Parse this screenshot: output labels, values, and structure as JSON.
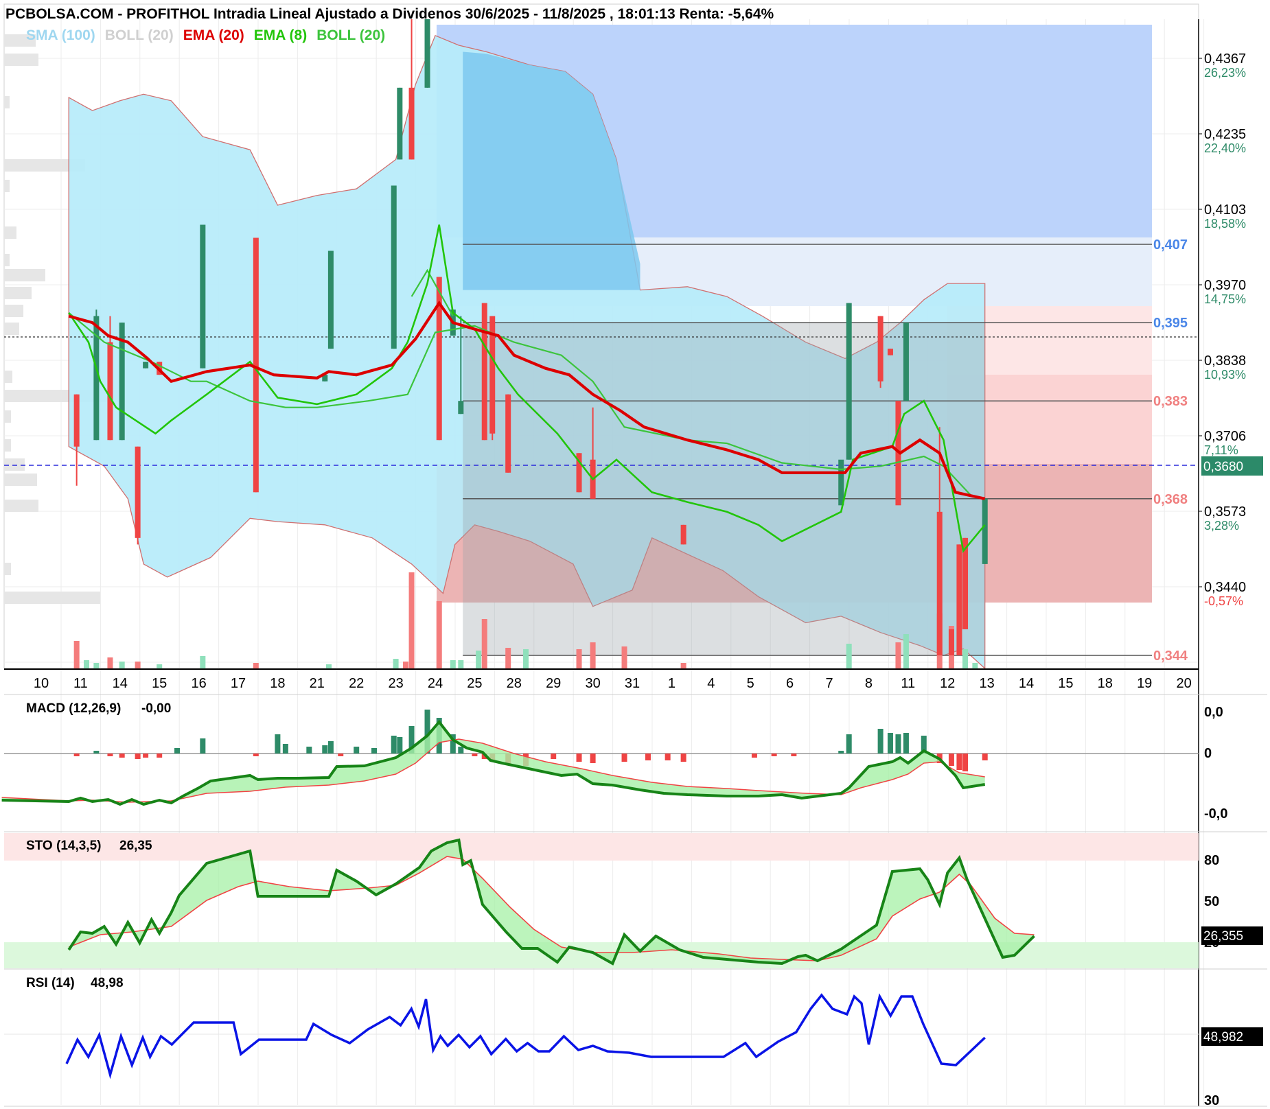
{
  "title": "PCBOLSA.COM - PROFITHOL Intradia Lineal Ajustado a Dividenos 30/6/2025 - 11/8/2025 , 18:01:13 Renta: -5,64%",
  "colors": {
    "up": "#2e8b68",
    "down": "#ef4444",
    "boll_fill": "#b8ecfa",
    "projection": "#bcd3fb",
    "ema20": "#dc0000",
    "ema8": "#22c50a",
    "boll20": "#3cc43c",
    "sma100": "#9fd7f0",
    "current": "#2c8a69",
    "macd": "#178417",
    "rsi": "#0a14e6"
  },
  "legend": [
    {
      "label": "SMA (100)",
      "color": "#9fd7f0"
    },
    {
      "label": "BOLL (20)",
      "color": "#d0d0d0"
    },
    {
      "label": "EMA (20)",
      "color": "#dc0000"
    },
    {
      "label": "EMA (8)",
      "color": "#22c50a"
    },
    {
      "label": "BOLL (20)",
      "color": "#3cc43c"
    }
  ],
  "chart_data": [
    {
      "type": "candlestick",
      "panel": "price",
      "x_tick_labels": [
        "10",
        "11",
        "14",
        "15",
        "16",
        "17",
        "18",
        "21",
        "22",
        "23",
        "24",
        "25",
        "28",
        "29",
        "30",
        "31",
        "1",
        "4",
        "5",
        "6",
        "7",
        "8",
        "11",
        "12",
        "13",
        "14",
        "15",
        "18",
        "19",
        "20"
      ],
      "y_ticks": [
        {
          "price": "0,4367",
          "pct": "26,23%",
          "pct_color": "#2e8b68"
        },
        {
          "price": "0,4235",
          "pct": "22,40%",
          "pct_color": "#2e8b68"
        },
        {
          "price": "0,4103",
          "pct": "18,58%",
          "pct_color": "#2e8b68"
        },
        {
          "price": "0,3970",
          "pct": "14,75%",
          "pct_color": "#2e8b68"
        },
        {
          "price": "0,3838",
          "pct": "10,93%",
          "pct_color": "#2e8b68"
        },
        {
          "price": "0,3706",
          "pct": "7,11%",
          "pct_color": "#2e8b68"
        },
        {
          "price": "0,3573",
          "pct": "3,28%",
          "pct_color": "#2e8b68"
        },
        {
          "price": "0,3440",
          "pct": "-0,57%",
          "pct_color": "#ef4444"
        }
      ],
      "ylim": [
        0.342,
        0.4415
      ],
      "current_price": "0,3680",
      "levels": [
        {
          "value": 0.407,
          "label": "0,407",
          "color": "#4a86e8"
        },
        {
          "value": 0.395,
          "label": "0,395",
          "color": "#4a86e8"
        },
        {
          "value": 0.383,
          "label": "0,383",
          "color": "#f08080"
        },
        {
          "value": 0.368,
          "label": "0,368",
          "color": "#f08080"
        },
        {
          "value": 0.344,
          "label": "0,344",
          "color": "#f08080"
        }
      ],
      "candles": [
        {
          "x": 0.9,
          "o": 0.384,
          "h": 0.384,
          "l": 0.37,
          "c": 0.376,
          "d": "down"
        },
        {
          "x": 1.4,
          "o": 0.377,
          "h": 0.397,
          "l": 0.377,
          "c": 0.396,
          "d": "up"
        },
        {
          "x": 1.75,
          "o": 0.392,
          "h": 0.396,
          "l": 0.377,
          "c": 0.377,
          "d": "down"
        },
        {
          "x": 2.05,
          "o": 0.377,
          "h": 0.395,
          "l": 0.377,
          "c": 0.395,
          "d": "up"
        },
        {
          "x": 2.45,
          "o": 0.376,
          "h": 0.376,
          "l": 0.361,
          "c": 0.362,
          "d": "down"
        },
        {
          "x": 2.65,
          "o": 0.389,
          "h": 0.389,
          "l": 0.388,
          "c": 0.388,
          "d": "up"
        },
        {
          "x": 3.0,
          "o": 0.389,
          "h": 0.389,
          "l": 0.387,
          "c": 0.387,
          "d": "down"
        },
        {
          "x": 4.1,
          "o": 0.388,
          "h": 0.41,
          "l": 0.388,
          "c": 0.41,
          "d": "up"
        },
        {
          "x": 5.45,
          "o": 0.408,
          "h": 0.408,
          "l": 0.369,
          "c": 0.369,
          "d": "down"
        },
        {
          "x": 7.2,
          "o": 0.387,
          "h": 0.387,
          "l": 0.386,
          "c": 0.386,
          "d": "up"
        },
        {
          "x": 7.35,
          "o": 0.391,
          "h": 0.406,
          "l": 0.391,
          "c": 0.406,
          "d": "up"
        },
        {
          "x": 8.95,
          "o": 0.391,
          "h": 0.416,
          "l": 0.391,
          "c": 0.416,
          "d": "up"
        },
        {
          "x": 9.1,
          "o": 0.42,
          "h": 0.431,
          "l": 0.42,
          "c": 0.431,
          "d": "up"
        },
        {
          "x": 9.4,
          "o": 0.431,
          "h": 0.442,
          "l": 0.42,
          "c": 0.42,
          "d": "down"
        },
        {
          "x": 9.8,
          "o": 0.431,
          "h": 0.442,
          "l": 0.431,
          "c": 0.442,
          "d": "up"
        },
        {
          "x": 10.1,
          "o": 0.402,
          "h": 0.402,
          "l": 0.377,
          "c": 0.377,
          "d": "down"
        },
        {
          "x": 10.45,
          "o": 0.393,
          "h": 0.397,
          "l": 0.393,
          "c": 0.397,
          "d": "up"
        },
        {
          "x": 10.65,
          "o": 0.381,
          "h": 0.396,
          "l": 0.381,
          "c": 0.383,
          "d": "up"
        },
        {
          "x": 11.25,
          "o": 0.398,
          "h": 0.398,
          "l": 0.377,
          "c": 0.377,
          "d": "down"
        },
        {
          "x": 11.45,
          "o": 0.396,
          "h": 0.396,
          "l": 0.377,
          "c": 0.378,
          "d": "down"
        },
        {
          "x": 11.85,
          "o": 0.384,
          "h": 0.384,
          "l": 0.372,
          "c": 0.372,
          "d": "down"
        },
        {
          "x": 13.65,
          "o": 0.375,
          "h": 0.375,
          "l": 0.369,
          "c": 0.369,
          "d": "down"
        },
        {
          "x": 14.0,
          "o": 0.374,
          "h": 0.382,
          "l": 0.368,
          "c": 0.368,
          "d": "down"
        },
        {
          "x": 16.3,
          "o": 0.364,
          "h": 0.364,
          "l": 0.361,
          "c": 0.361,
          "d": "down"
        },
        {
          "x": 20.3,
          "o": 0.367,
          "h": 0.367,
          "l": 0.367,
          "c": 0.374,
          "d": "up"
        },
        {
          "x": 20.5,
          "o": 0.374,
          "h": 0.398,
          "l": 0.374,
          "c": 0.398,
          "d": "up"
        },
        {
          "x": 21.3,
          "o": 0.396,
          "h": 0.396,
          "l": 0.385,
          "c": 0.386,
          "d": "down"
        },
        {
          "x": 21.55,
          "o": 0.391,
          "h": 0.391,
          "l": 0.39,
          "c": 0.39,
          "d": "down"
        },
        {
          "x": 21.75,
          "o": 0.383,
          "h": 0.383,
          "l": 0.368,
          "c": 0.367,
          "d": "down"
        },
        {
          "x": 21.95,
          "o": 0.383,
          "h": 0.395,
          "l": 0.383,
          "c": 0.395,
          "d": "up"
        },
        {
          "x": 22.8,
          "o": 0.366,
          "h": 0.379,
          "l": 0.344,
          "c": 0.344,
          "d": "down"
        },
        {
          "x": 23.1,
          "o": 0.348,
          "h": 0.348,
          "l": 0.344,
          "c": 0.344,
          "d": "down"
        },
        {
          "x": 23.3,
          "o": 0.361,
          "h": 0.361,
          "l": 0.344,
          "c": 0.344,
          "d": "down"
        },
        {
          "x": 23.45,
          "o": 0.362,
          "h": 0.362,
          "l": 0.348,
          "c": 0.348,
          "d": "down"
        },
        {
          "x": 23.95,
          "o": 0.358,
          "h": 0.368,
          "l": 0.358,
          "c": 0.368,
          "d": "up"
        }
      ]
    },
    {
      "type": "line",
      "panel": "macd",
      "name": "MACD (12,26,9)",
      "value_label": "-0,00",
      "y_ticks": [
        {
          "label": "0,0",
          "color": "#dc0000"
        },
        {
          "label": "0",
          "color": "#000000"
        },
        {
          "label": "-0,0",
          "color": "#178417"
        }
      ]
    },
    {
      "type": "line",
      "panel": "sto",
      "name": "STO (14,3,5)",
      "value_label": "26,35",
      "current": "26,355",
      "y_ticks": [
        {
          "label": "80",
          "color": "#dc0000"
        },
        {
          "label": "50",
          "color": "#000000"
        },
        {
          "label": "20",
          "color": "#178417"
        }
      ]
    },
    {
      "type": "line",
      "panel": "rsi",
      "name": "RSI (14)",
      "value_label": "48,98",
      "current": "48,982",
      "y_ticks": [
        {
          "label": "30",
          "color": "#000000"
        }
      ]
    }
  ]
}
